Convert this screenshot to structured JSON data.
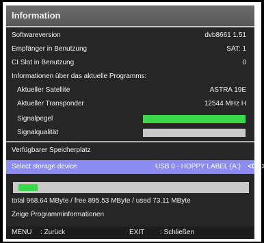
{
  "title": "Information",
  "rows": [
    {
      "label": "Softwareversion",
      "value": "dvb8661 1.51"
    },
    {
      "label": "Empfänger in Benutzung",
      "value": "SAT: 1"
    },
    {
      "label": "CI Slot in Benutzung",
      "value": "0"
    },
    {
      "label": "Informationen über das aktuelle Programms:",
      "value": ""
    },
    {
      "label": "Aktueller Satellite",
      "value": "ASTRA 19E"
    },
    {
      "label": "Aktueller Transponder",
      "value": "12544 MHz H"
    }
  ],
  "signal_level": {
    "label": "Signalpegel",
    "fraction": 1.0
  },
  "signal_quality": {
    "label": "Signalqualität",
    "fraction": 0.0
  },
  "storage_header": "Verfügbarer Speicherplatz",
  "storage_select": {
    "label": "Select storage device",
    "value": "USB 0 - HOPPY LABEL (A:)"
  },
  "ok_hint": "<OK>",
  "storage_usage_fraction": 0.08,
  "storage_summary": "total 968.64 MByte / free 895.53 MByte / used 73.11 MByte",
  "program_info": "Zeige Programminformationen",
  "footer": {
    "menu_key": "MENU",
    "menu_action": ": Zurück",
    "exit_key": "EXIT",
    "exit_action": ": Schließen"
  },
  "colors": {
    "title_bar": "#5f5f5f",
    "panel": "#262626",
    "bar_fill": "#39d94a",
    "bar_empty": "#c9c9c9",
    "selection": "#8b8bf0"
  }
}
